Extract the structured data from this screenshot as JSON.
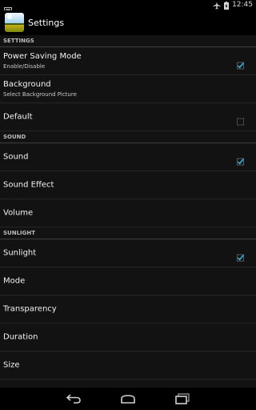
{
  "status_bar": {
    "time": "12:45",
    "icons": [
      "notification-icon",
      "airplane-icon",
      "battery-charging-icon"
    ]
  },
  "action_bar": {
    "title": "Settings",
    "app_icon": "sunlight-app-icon"
  },
  "sections": [
    {
      "header": "SETTINGS",
      "items": [
        {
          "title": "Power Saving Mode",
          "summary": "Enable/Disable",
          "checkbox": true,
          "checked": true
        },
        {
          "title": "Background",
          "summary": "Select Background Picture",
          "checkbox": false
        },
        {
          "title": "Default",
          "checkbox": true,
          "checked": false
        }
      ]
    },
    {
      "header": "SOUND",
      "items": [
        {
          "title": "Sound",
          "checkbox": true,
          "checked": true
        },
        {
          "title": "Sound Effect",
          "checkbox": false
        },
        {
          "title": "Volume",
          "checkbox": false
        }
      ]
    },
    {
      "header": "SUNLIGHT",
      "items": [
        {
          "title": "Sunlight",
          "checkbox": true,
          "checked": true
        },
        {
          "title": "Mode",
          "checkbox": false
        },
        {
          "title": "Transparency",
          "checkbox": false
        },
        {
          "title": "Duration",
          "checkbox": false
        },
        {
          "title": "Size",
          "checkbox": false
        }
      ]
    }
  ],
  "nav_bar": {
    "icons": [
      "back-icon",
      "home-icon",
      "recent-apps-icon"
    ]
  },
  "colors": {
    "accent": "#33b5e5",
    "background": "#121212",
    "bar": "#000000"
  }
}
